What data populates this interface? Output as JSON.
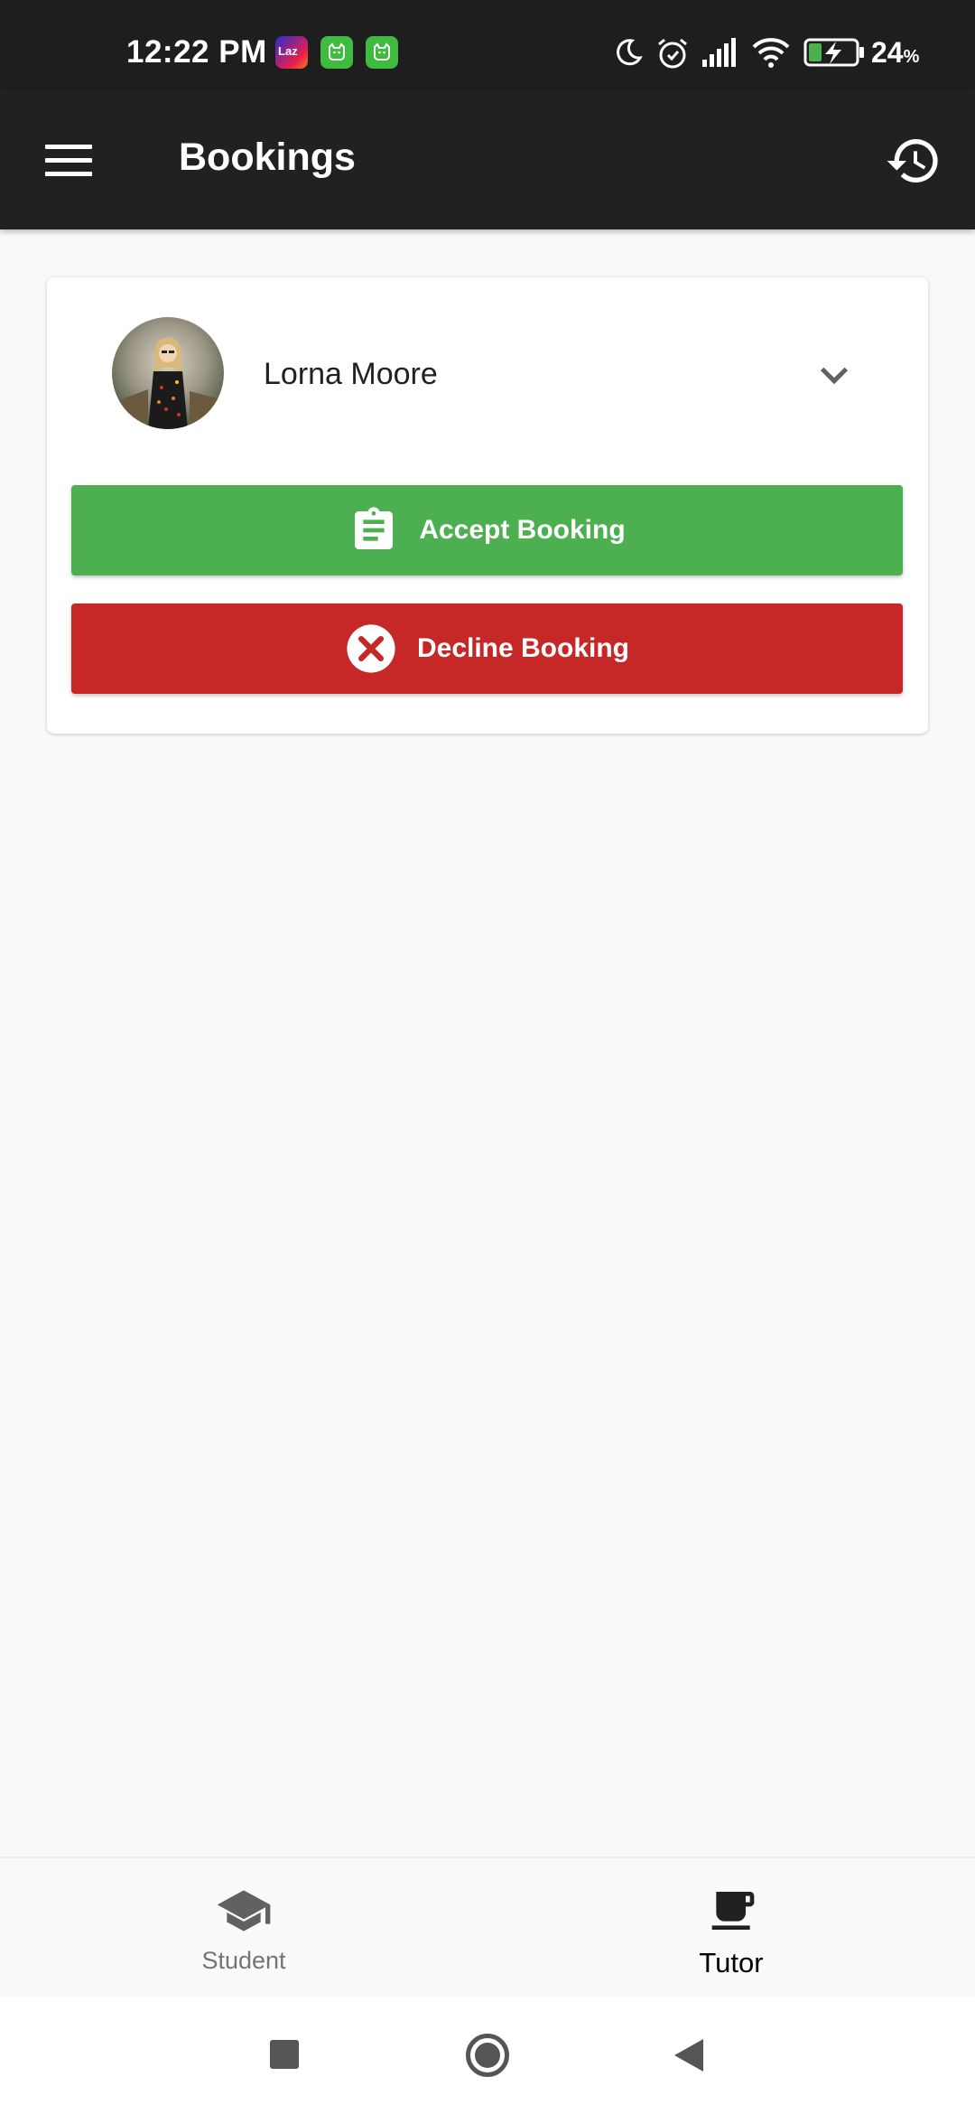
{
  "status_bar": {
    "time": "12:22 PM",
    "battery_percent": "24",
    "battery_unit": "%",
    "notification_app": "Laz",
    "icons": [
      "lazada-icon",
      "cat-app-icon",
      "cat-app-icon",
      "moon-icon",
      "alarm-icon",
      "signal-icon",
      "wifi-icon",
      "battery-charging-icon"
    ]
  },
  "app_bar": {
    "title": "Bookings",
    "menu_icon": "menu-icon",
    "history_icon": "history-icon"
  },
  "booking_card": {
    "name": "Lorna Moore",
    "expand_icon": "chevron-down-icon",
    "accept_label": "Accept Booking",
    "accept_icon": "clipboard-icon",
    "decline_label": "Decline Booking",
    "decline_icon": "cancel-icon"
  },
  "bottom_nav": {
    "items": [
      {
        "label": "Student",
        "icon": "graduation-cap-icon",
        "selected": false
      },
      {
        "label": "Tutor",
        "icon": "coffee-cup-icon",
        "selected": true
      }
    ]
  },
  "colors": {
    "app_bar": "#212121",
    "status_bar": "#1e1e1e",
    "accept": "#4caf50",
    "decline": "#c62828",
    "background": "#fafafa"
  }
}
